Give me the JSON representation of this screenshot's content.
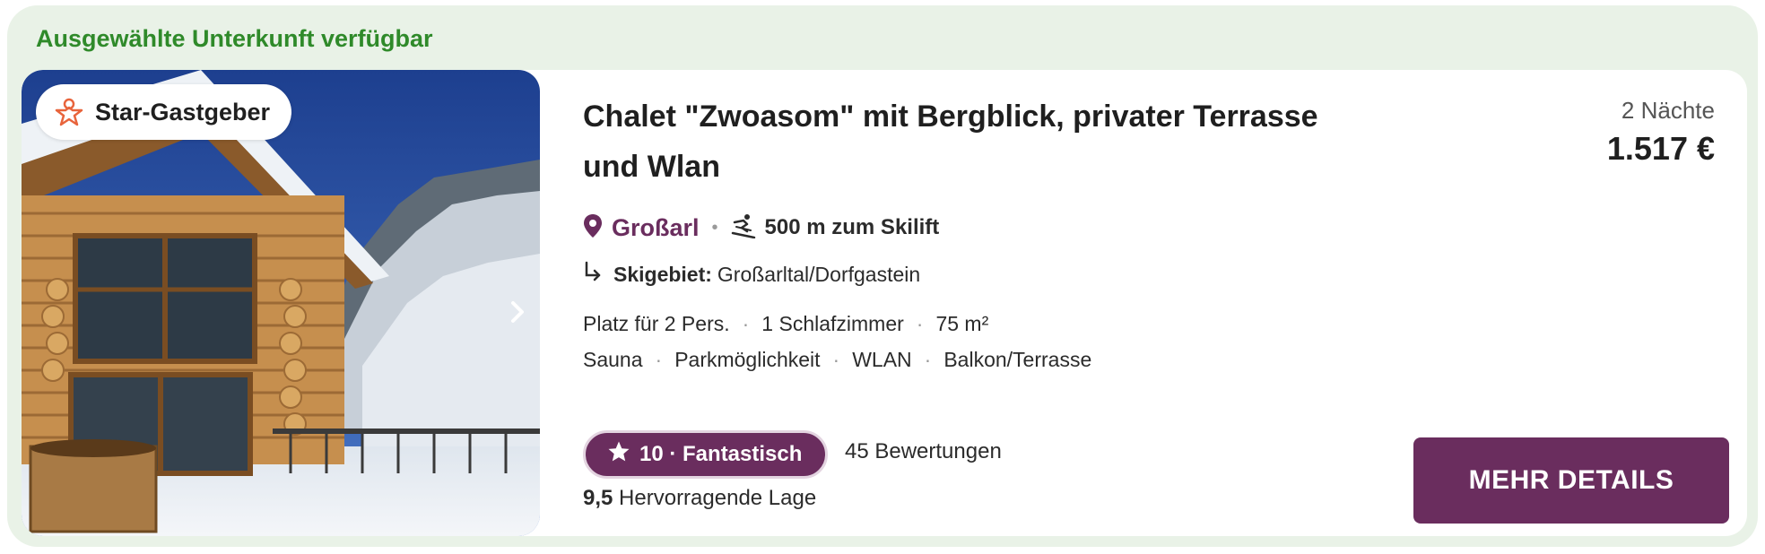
{
  "header": {
    "label": "Ausgewählte Unterkunft verfügbar"
  },
  "listing": {
    "badge": "Star-Gastgeber",
    "title": "Chalet \"Zwoasom\" mit Bergblick, privater Terrasse und Wlan",
    "location": {
      "city": "Großarl",
      "distance": "500 m zum Skilift",
      "ski_area_label": "Skigebiet:",
      "ski_area_value": "Großarltal/Dorfgastein"
    },
    "facts": [
      "Platz für 2 Pers.",
      "1 Schlafzimmer",
      "75 m²"
    ],
    "amenities": [
      "Sauna",
      "Parkmöglichkeit",
      "WLAN",
      "Balkon/Terrasse"
    ],
    "rating": {
      "label": "10 · Fantastisch",
      "reviews": "45 Bewertungen",
      "location_score": "9,5",
      "location_text": "Hervorragende Lage"
    },
    "price": {
      "nights": "2 Nächte",
      "total": "1.517 €"
    },
    "cta": "MEHR DETAILS"
  },
  "colors": {
    "accent": "#6a2d5e",
    "header_green": "#2f8a2a",
    "background": "#e9f2e7",
    "badge_star": "#e8643c"
  },
  "icons": {
    "badge": "star-host-icon",
    "location": "map-pin-icon",
    "skilift": "skier-icon",
    "ski_area": "arrow-turn-icon",
    "rating": "star-icon",
    "gallery_next": "chevron-right-icon"
  }
}
